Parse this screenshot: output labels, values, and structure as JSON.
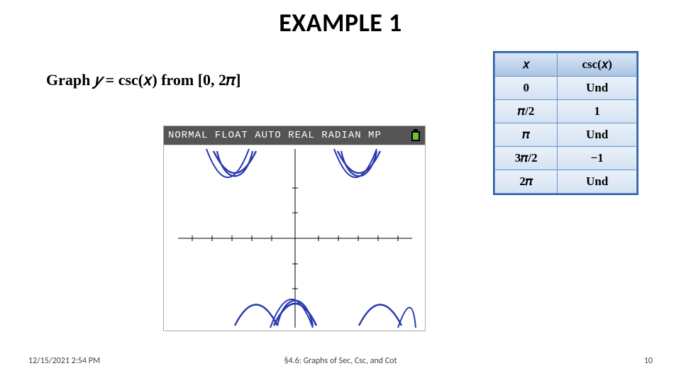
{
  "title": "EXAMPLE 1",
  "prompt": {
    "pre": "Graph ",
    "eq_lhs": "𝑦",
    "eq_eq": " = ",
    "eq_rhs": "csc(𝑥)",
    "mid": " from ",
    "domain": "[0, 2𝜋]"
  },
  "calc": {
    "header": "NORMAL FLOAT AUTO REAL RADIAN MP"
  },
  "table": {
    "head": {
      "x": "𝑥",
      "fx": "csc(𝑥)"
    },
    "rows": [
      {
        "x": "0",
        "fx": "Und"
      },
      {
        "x": "𝜋/2",
        "fx": "1"
      },
      {
        "x": "𝜋",
        "fx": "Und"
      },
      {
        "x": "3𝜋/2",
        "fx": "−1"
      },
      {
        "x": "2𝜋",
        "fx": "Und"
      }
    ]
  },
  "footer": {
    "left": "12/15/2021 2:54 PM",
    "center": "§4.6: Graphs of Sec, Csc, and Cot",
    "right": "10"
  },
  "chart_data": {
    "type": "line",
    "title": "",
    "xlabel": "",
    "ylabel": "",
    "xlim": [
      -3.14,
      9.42
    ],
    "ylim": [
      -4,
      4
    ],
    "function": "csc(x)",
    "asymptotes_x": [
      0,
      3.1416,
      6.2832
    ],
    "series": [
      {
        "name": "csc(x)",
        "note": "piecewise branches between vertical asymptotes"
      }
    ]
  }
}
